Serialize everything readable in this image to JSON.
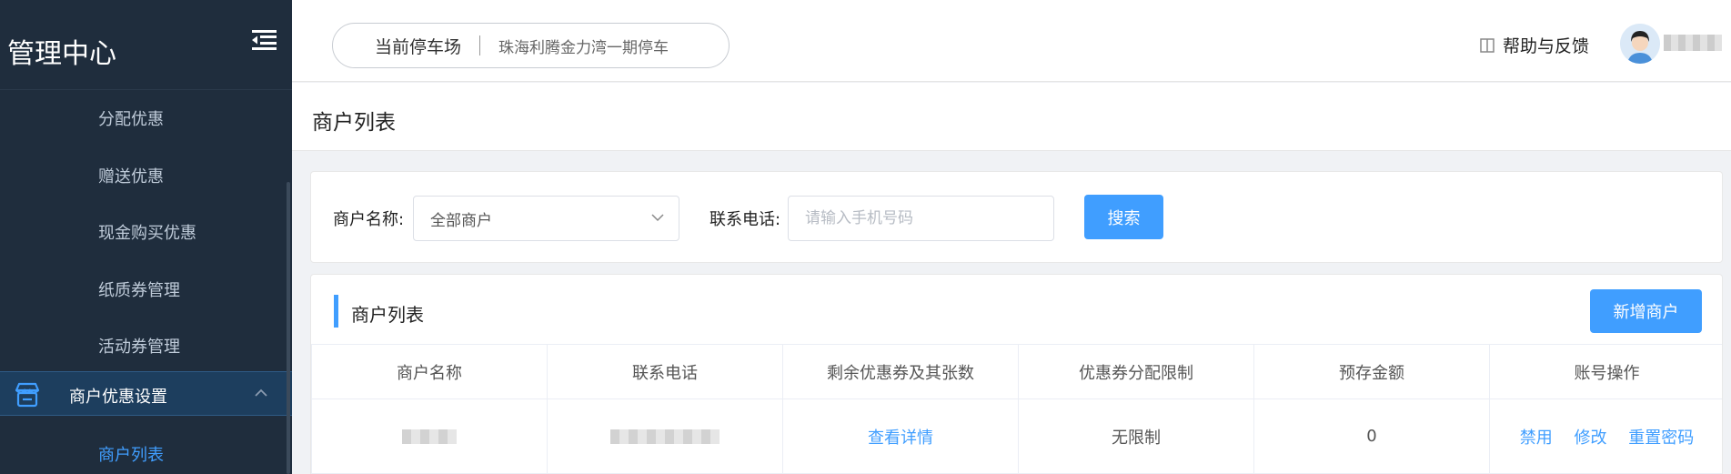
{
  "sidebar": {
    "title": "管理中心",
    "items": [
      {
        "label": "分配优惠"
      },
      {
        "label": "赠送优惠"
      },
      {
        "label": "现金购买优惠"
      },
      {
        "label": "纸质券管理"
      },
      {
        "label": "活动券管理"
      }
    ],
    "group": {
      "label": "商户优惠设置",
      "icon": "store-icon"
    },
    "active_sub": "商户列表"
  },
  "topbar": {
    "lot_label": "当前停车场",
    "lot_value": "珠海利腾金力湾一期停车",
    "help": "帮助与反馈"
  },
  "page": {
    "title": "商户列表"
  },
  "search": {
    "merchant_label": "商户名称:",
    "merchant_selected": "全部商户",
    "phone_label": "联系电话:",
    "phone_placeholder": "请输入手机号码",
    "search_button": "搜索"
  },
  "list": {
    "title": "商户列表",
    "add_button": "新增商户",
    "columns": [
      "商户名称",
      "联系电话",
      "剩余优惠券及其张数",
      "优惠券分配限制",
      "预存金额",
      "账号操作"
    ],
    "rows": [
      {
        "details": "查看详情",
        "limit": "无限制",
        "deposit": "0",
        "ops": [
          "禁用",
          "修改",
          "重置密码"
        ]
      }
    ]
  },
  "colors": {
    "sidebar_bg": "#1f2d3d",
    "accent": "#409eff"
  }
}
